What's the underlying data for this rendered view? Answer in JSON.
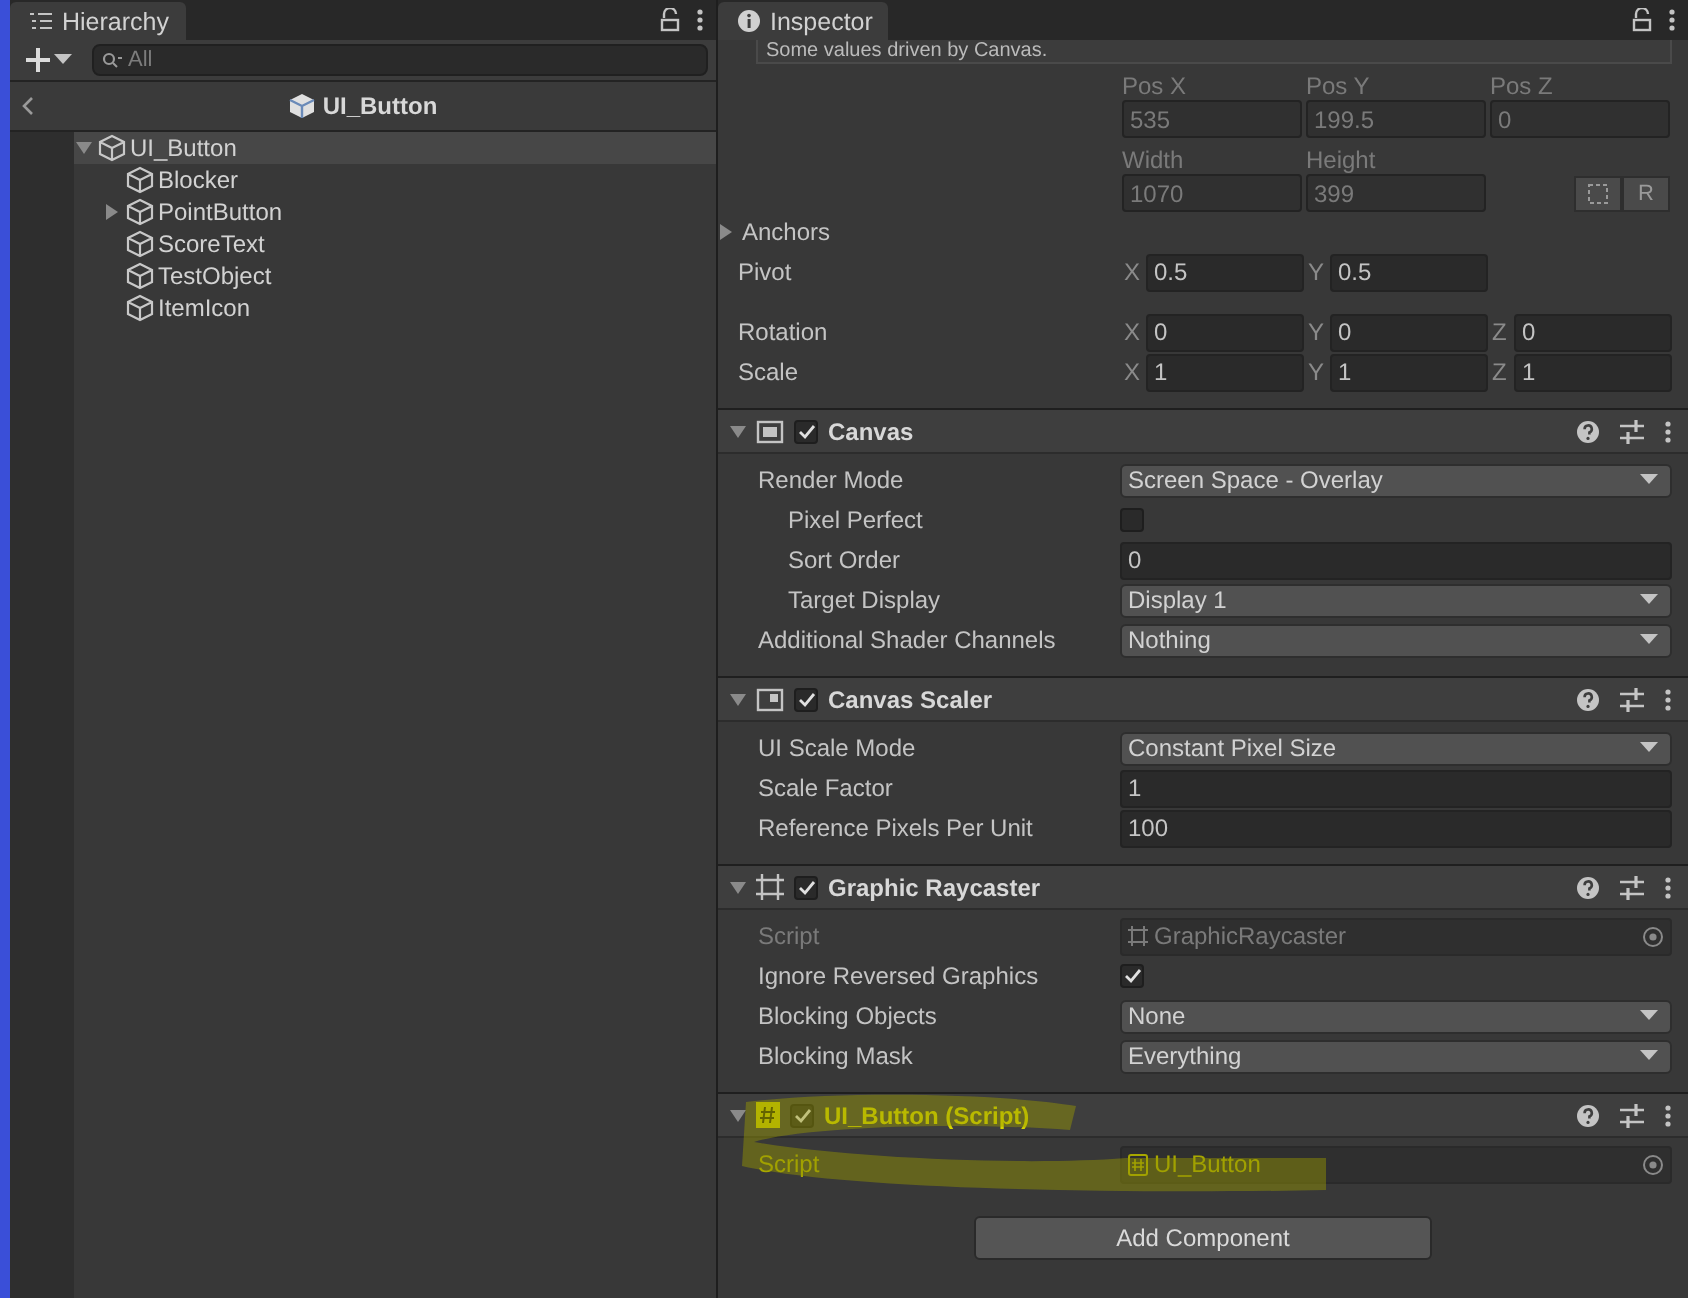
{
  "hierarchy": {
    "tab": "Hierarchy",
    "search": {
      "placeholder": "All"
    },
    "scene": "UI_Button",
    "tree": [
      {
        "label": "UI_Button",
        "kind": "group",
        "expanded": true,
        "selected": true,
        "children": [
          {
            "label": "Blocker",
            "kind": "leaf",
            "selected": false
          },
          {
            "label": "PointButton",
            "kind": "group",
            "expanded": false,
            "selected": false
          },
          {
            "label": "ScoreText",
            "kind": "leaf",
            "selected": false
          },
          {
            "label": "TestObject",
            "kind": "leaf",
            "selected": false
          },
          {
            "label": "ItemIcon",
            "kind": "leaf",
            "selected": false
          }
        ]
      }
    ]
  },
  "inspector": {
    "tab": "Inspector",
    "rect_transform": {
      "notice": "Some values driven by Canvas.",
      "position_fields": [
        {
          "label": "Pos X",
          "value": "535",
          "disabled": true
        },
        {
          "label": "Pos Y",
          "value": "199.5",
          "disabled": true
        },
        {
          "label": "Pos Z",
          "value": "0",
          "disabled": true
        }
      ],
      "size_fields": [
        {
          "label": "Width",
          "value": "1070",
          "disabled": true
        },
        {
          "label": "Height",
          "value": "399",
          "disabled": true
        }
      ],
      "reset_button": "R",
      "rows": [
        {
          "kind": "foldout",
          "label": "Anchors",
          "expanded": false
        },
        {
          "kind": "vector",
          "label": "Pivot",
          "axes": [
            {
              "axis": "X",
              "value": "0.5"
            },
            {
              "axis": "Y",
              "value": "0.5"
            }
          ]
        },
        {
          "kind": "vector",
          "label": "Rotation",
          "axes": [
            {
              "axis": "X",
              "value": "0"
            },
            {
              "axis": "Y",
              "value": "0"
            },
            {
              "axis": "Z",
              "value": "0"
            }
          ]
        },
        {
          "kind": "vector",
          "label": "Scale",
          "axes": [
            {
              "axis": "X",
              "value": "1"
            },
            {
              "axis": "Y",
              "value": "1"
            },
            {
              "axis": "Z",
              "value": "1"
            }
          ]
        }
      ]
    },
    "components": [
      {
        "title": "Canvas",
        "kind": "canvas",
        "enabled": true,
        "expanded": true,
        "highlighted": false,
        "rows": [
          {
            "kind": "dropdown",
            "label": "Render Mode",
            "value": "Screen Space - Overlay",
            "disabled": false,
            "children": [
              {
                "kind": "checkbox",
                "label": "Pixel Perfect",
                "checked": false,
                "disabled": false
              },
              {
                "kind": "text",
                "label": "Sort Order",
                "value": "0",
                "disabled": false
              },
              {
                "kind": "dropdown",
                "label": "Target Display",
                "value": "Display 1",
                "disabled": false
              }
            ]
          },
          {
            "kind": "dropdown",
            "label": "Additional Shader Channels",
            "value": "Nothing",
            "disabled": false
          }
        ]
      },
      {
        "title": "Canvas Scaler",
        "kind": "scaler",
        "enabled": true,
        "expanded": true,
        "highlighted": false,
        "rows": [
          {
            "kind": "dropdown",
            "label": "UI Scale Mode",
            "value": "Constant Pixel Size",
            "disabled": false
          },
          {
            "kind": "text",
            "label": "Scale Factor",
            "value": "1",
            "disabled": false
          },
          {
            "kind": "text",
            "label": "Reference Pixels Per Unit",
            "value": "100",
            "disabled": false
          }
        ]
      },
      {
        "title": "Graphic Raycaster",
        "kind": "raycaster",
        "enabled": true,
        "expanded": true,
        "highlighted": false,
        "rows": [
          {
            "kind": "object",
            "label": "Script",
            "value": "GraphicRaycaster",
            "disabled": true
          },
          {
            "kind": "checkbox",
            "label": "Ignore Reversed Graphics",
            "checked": true,
            "disabled": false
          },
          {
            "kind": "dropdown",
            "label": "Blocking Objects",
            "value": "None",
            "disabled": false
          },
          {
            "kind": "dropdown",
            "label": "Blocking Mask",
            "value": "Everything",
            "disabled": false
          }
        ]
      },
      {
        "title": "UI_Button (Script)",
        "kind": "script",
        "enabled": true,
        "expanded": true,
        "highlighted": true,
        "rows": [
          {
            "kind": "object",
            "label": "Script",
            "value": "UI_Button",
            "disabled": true
          }
        ]
      }
    ],
    "add_button": "Add Component"
  }
}
